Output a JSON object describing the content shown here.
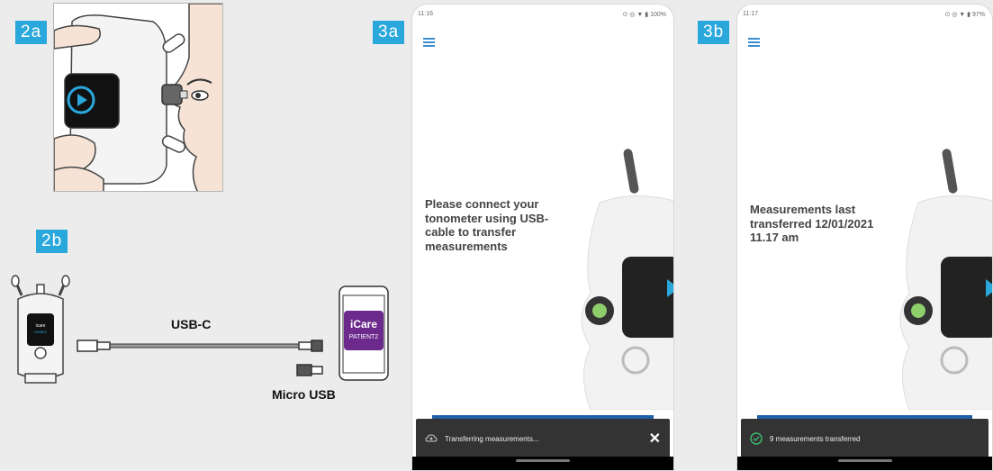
{
  "badges": {
    "step_2a": "2a",
    "step_2b": "2b",
    "step_3a": "3a",
    "step_3b": "3b"
  },
  "cable": {
    "usb_c_label": "USB-C",
    "micro_usb_label": "Micro USB"
  },
  "app_icon": {
    "line1": "iCare",
    "line2": "PATIENT2"
  },
  "device_screen": {
    "brand": "icare",
    "model": "HOME2"
  },
  "phone_3a": {
    "time": "11:16",
    "battery": "100%",
    "message": "Please connect your tonometer using USB-cable to transfer measurements",
    "snackbar_text": "Transferring measurements...",
    "close_label": "✕"
  },
  "phone_3b": {
    "time": "11:17",
    "battery": "97%",
    "message": "Measurements last transferred 12/01/2021 11.17 am",
    "snackbar_text": "9 measurements transferred"
  },
  "colors": {
    "accent": "#2aa8dc",
    "app_purple": "#6b2a8c",
    "menu_blue": "#3a8ed0",
    "success_green": "#3dbb6e"
  }
}
